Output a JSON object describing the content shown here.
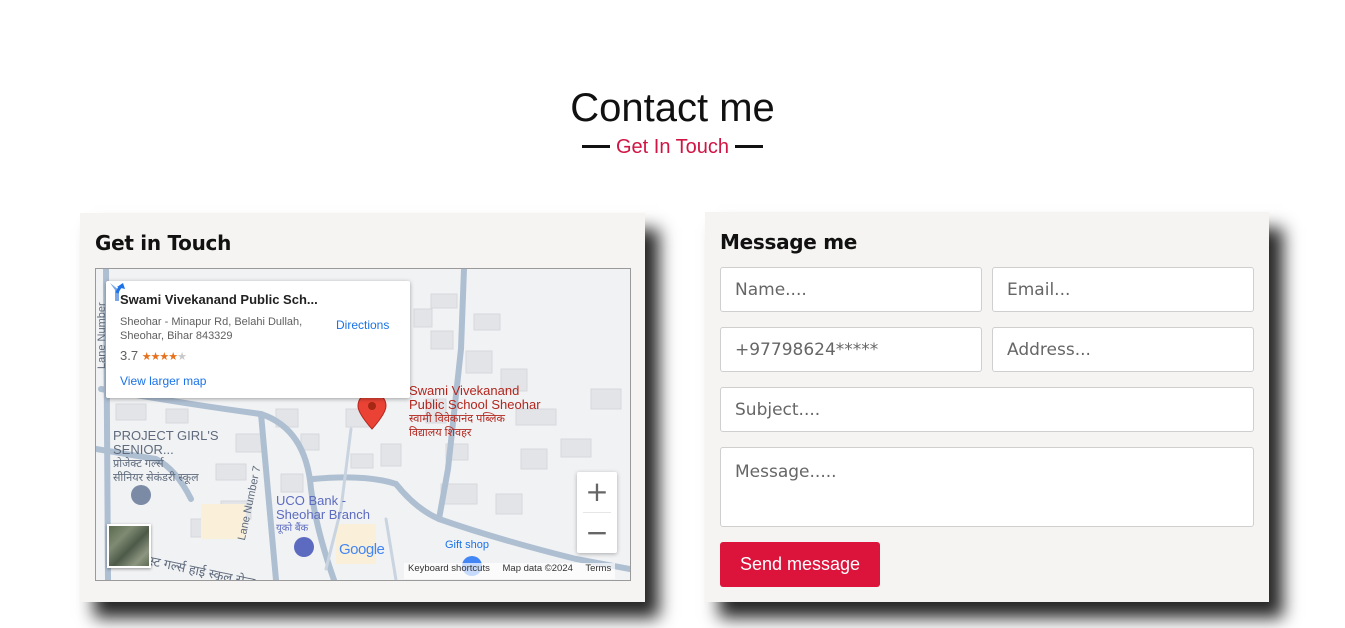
{
  "section": {
    "title": "Contact me",
    "subtitle": "Get In Touch"
  },
  "left_card": {
    "heading": "Get in Touch",
    "map": {
      "info": {
        "name": "Swami Vivekanand Public Sch...",
        "address_line1": "Sheohar - Minapur Rd, Belahi Dullah,",
        "address_line2": "Sheohar, Bihar 843329",
        "rating": "3.7",
        "stars": "★★★★",
        "stars_off": "★",
        "view_larger": "View larger map",
        "directions": "Directions"
      },
      "labels": {
        "school_en_1": "Swami Vivekanand",
        "school_en_2": "Public School Sheohar",
        "school_hi_1": "स्वामी विवेकानंद पब्लिक",
        "school_hi_2": "विद्यालय शिवहर",
        "project_1": "PROJECT GIRL'S",
        "project_2": "SENIOR...",
        "project_hi_1": "प्रोजेक्ट गर्ल्स",
        "project_hi_2": "सीनियर सेकंडरी स्कूल",
        "bank_1": "UCO Bank -",
        "bank_2": "Sheohar Branch",
        "bank_hi": "यूको बैंक",
        "gift": "Gift shop",
        "lane_number": "Lane Number",
        "lane_number_7": "Lane Number 7",
        "road_hi": "स्ट गर्ल्स हाई स्कूल सेन्ट"
      },
      "zoom_in": "+",
      "zoom_out": "−",
      "google": "Google",
      "attribution": {
        "shortcuts": "Keyboard shortcuts",
        "map_data": "Map data ©2024",
        "terms": "Terms"
      }
    }
  },
  "right_card": {
    "heading": "Message me",
    "form": {
      "name_placeholder": "Name....",
      "email_placeholder": "Email...",
      "phone_placeholder": "+97798624*****",
      "address_placeholder": "Address...",
      "subject_placeholder": "Subject....",
      "message_placeholder": "Message.....",
      "send_label": "Send message"
    }
  },
  "colors": {
    "accent": "#dc143c",
    "card_bg": "#f5f4f2"
  }
}
